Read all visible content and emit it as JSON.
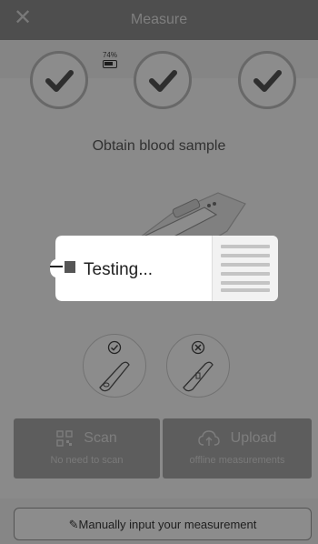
{
  "header": {
    "title": "Measure",
    "close_icon": "close-icon"
  },
  "battery": {
    "percent": "74%",
    "level": 0.74
  },
  "steps": [
    {
      "name": "step-1",
      "icon": "checkmark-icon",
      "done": true
    },
    {
      "name": "step-2",
      "icon": "checkmark-icon",
      "done": true
    },
    {
      "name": "step-3",
      "icon": "checkmark-icon",
      "done": true
    }
  ],
  "instruction": "Obtain blood sample",
  "finger_options": [
    {
      "icon": "check-circle-icon"
    },
    {
      "icon": "x-circle-icon"
    }
  ],
  "actions": {
    "scan": {
      "label": "Scan",
      "sub": "No need to scan",
      "icon": "qr-code-icon"
    },
    "upload": {
      "label": "Upload",
      "sub": "offline measurements",
      "icon": "cloud-upload-icon"
    }
  },
  "manual": {
    "label": "Manually input your measurement",
    "icon": "pencil-icon"
  },
  "dialog": {
    "label": "Testing..."
  },
  "colors": {
    "header": "#8e8e8e",
    "overlay": "rgba(0,0,0,0.45)",
    "tag": "#ffffff"
  }
}
